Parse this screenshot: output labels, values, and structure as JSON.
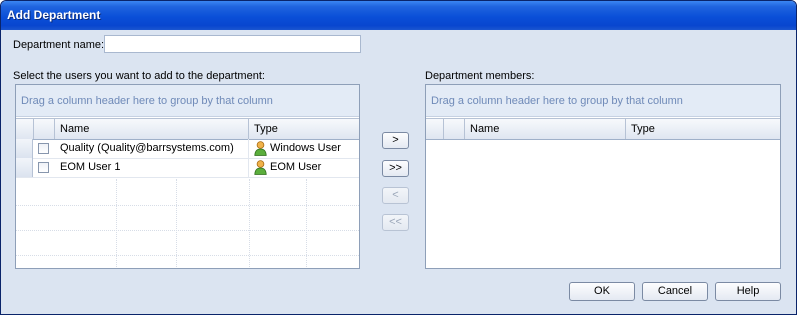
{
  "window": {
    "title": "Add Department"
  },
  "form": {
    "department_name_label": "Department name:",
    "department_name_value": "",
    "select_users_label": "Select the users you want to add to the department:",
    "members_label": "Department members:"
  },
  "users_grid": {
    "group_hint": "Drag a column header here to group by that column",
    "columns": [
      "Name",
      "Type"
    ],
    "rows": [
      {
        "name": "Quality (Quality@barrsystems.com)",
        "type": "Windows User",
        "icon": "user-icon"
      },
      {
        "name": "EOM User 1",
        "type": "EOM User",
        "icon": "user-icon"
      }
    ]
  },
  "members_grid": {
    "group_hint": "Drag a column header here to group by that column",
    "columns": [
      "Name",
      "Type"
    ]
  },
  "transfer_buttons": {
    "add_one": ">",
    "add_all": ">>",
    "remove_one": "<",
    "remove_all": "<<"
  },
  "footer": {
    "ok": "OK",
    "cancel": "Cancel",
    "help": "Help"
  },
  "colors": {
    "titlebar": "#0a4fd8",
    "client_bg": "#dbe4f1",
    "group_hint_text": "#6f8ab8"
  }
}
